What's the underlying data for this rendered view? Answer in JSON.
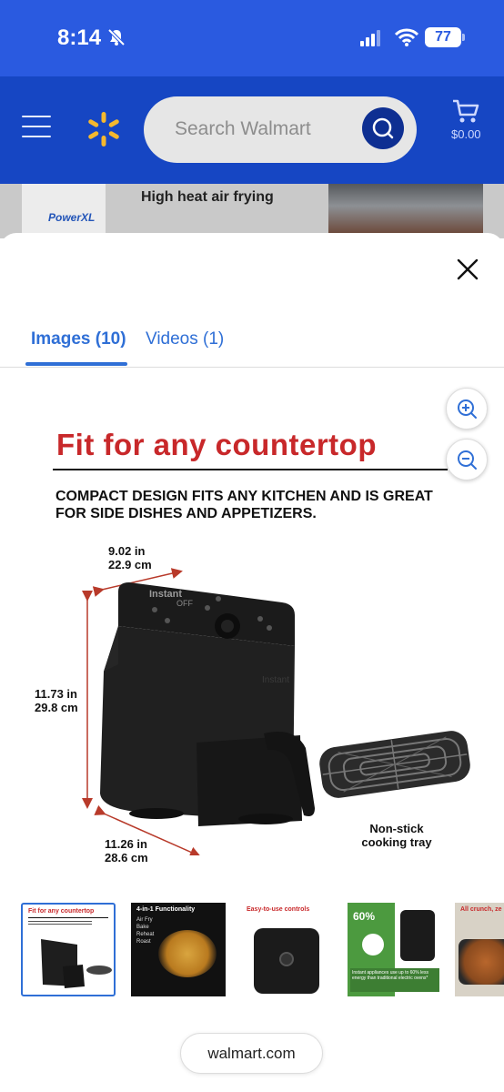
{
  "status_bar": {
    "time": "8:14",
    "battery": "77"
  },
  "header": {
    "search_placeholder": "Search Walmart",
    "cart_total": "$0.00"
  },
  "banner": {
    "brand": "PowerXL",
    "headline": "High heat air frying"
  },
  "viewer": {
    "tabs": [
      {
        "label": "Images (10)",
        "active": true
      },
      {
        "label": "Videos (1)",
        "active": false
      }
    ]
  },
  "product_image": {
    "title": "Fit for any countertop",
    "subtitle": "COMPACT DESIGN FITS ANY KITCHEN AND IS GREAT FOR SIDE DISHES AND APPETIZERS.",
    "width_in": "9.02 in",
    "width_cm": "22.9 cm",
    "height_in": "11.73 in",
    "height_cm": "29.8 cm",
    "depth_in": "11.26 in",
    "depth_cm": "28.6 cm",
    "tray_label": "Non-stick cooking tray",
    "brand_mark": "Instant",
    "display": "OFF"
  },
  "thumbnails": [
    {
      "title": "Fit for any countertop",
      "selected": true
    },
    {
      "title": "4-in-1 Functionality",
      "lines": [
        "Air Fry",
        "Bake",
        "Reheat",
        "Roast"
      ]
    },
    {
      "title": "Easy-to-use controls"
    },
    {
      "title": "60%",
      "caption": "Instant appliances use up to 60% less energy than traditional electric ovens*"
    },
    {
      "title": "All crunch, ze"
    }
  ],
  "footer": {
    "domain": "walmart.com"
  },
  "colors": {
    "walmart_blue": "#1646c3",
    "status_blue": "#2a5ae0",
    "spark_yellow": "#f5b82e",
    "accent_red": "#c8282a",
    "link_blue": "#2f6fd6"
  }
}
